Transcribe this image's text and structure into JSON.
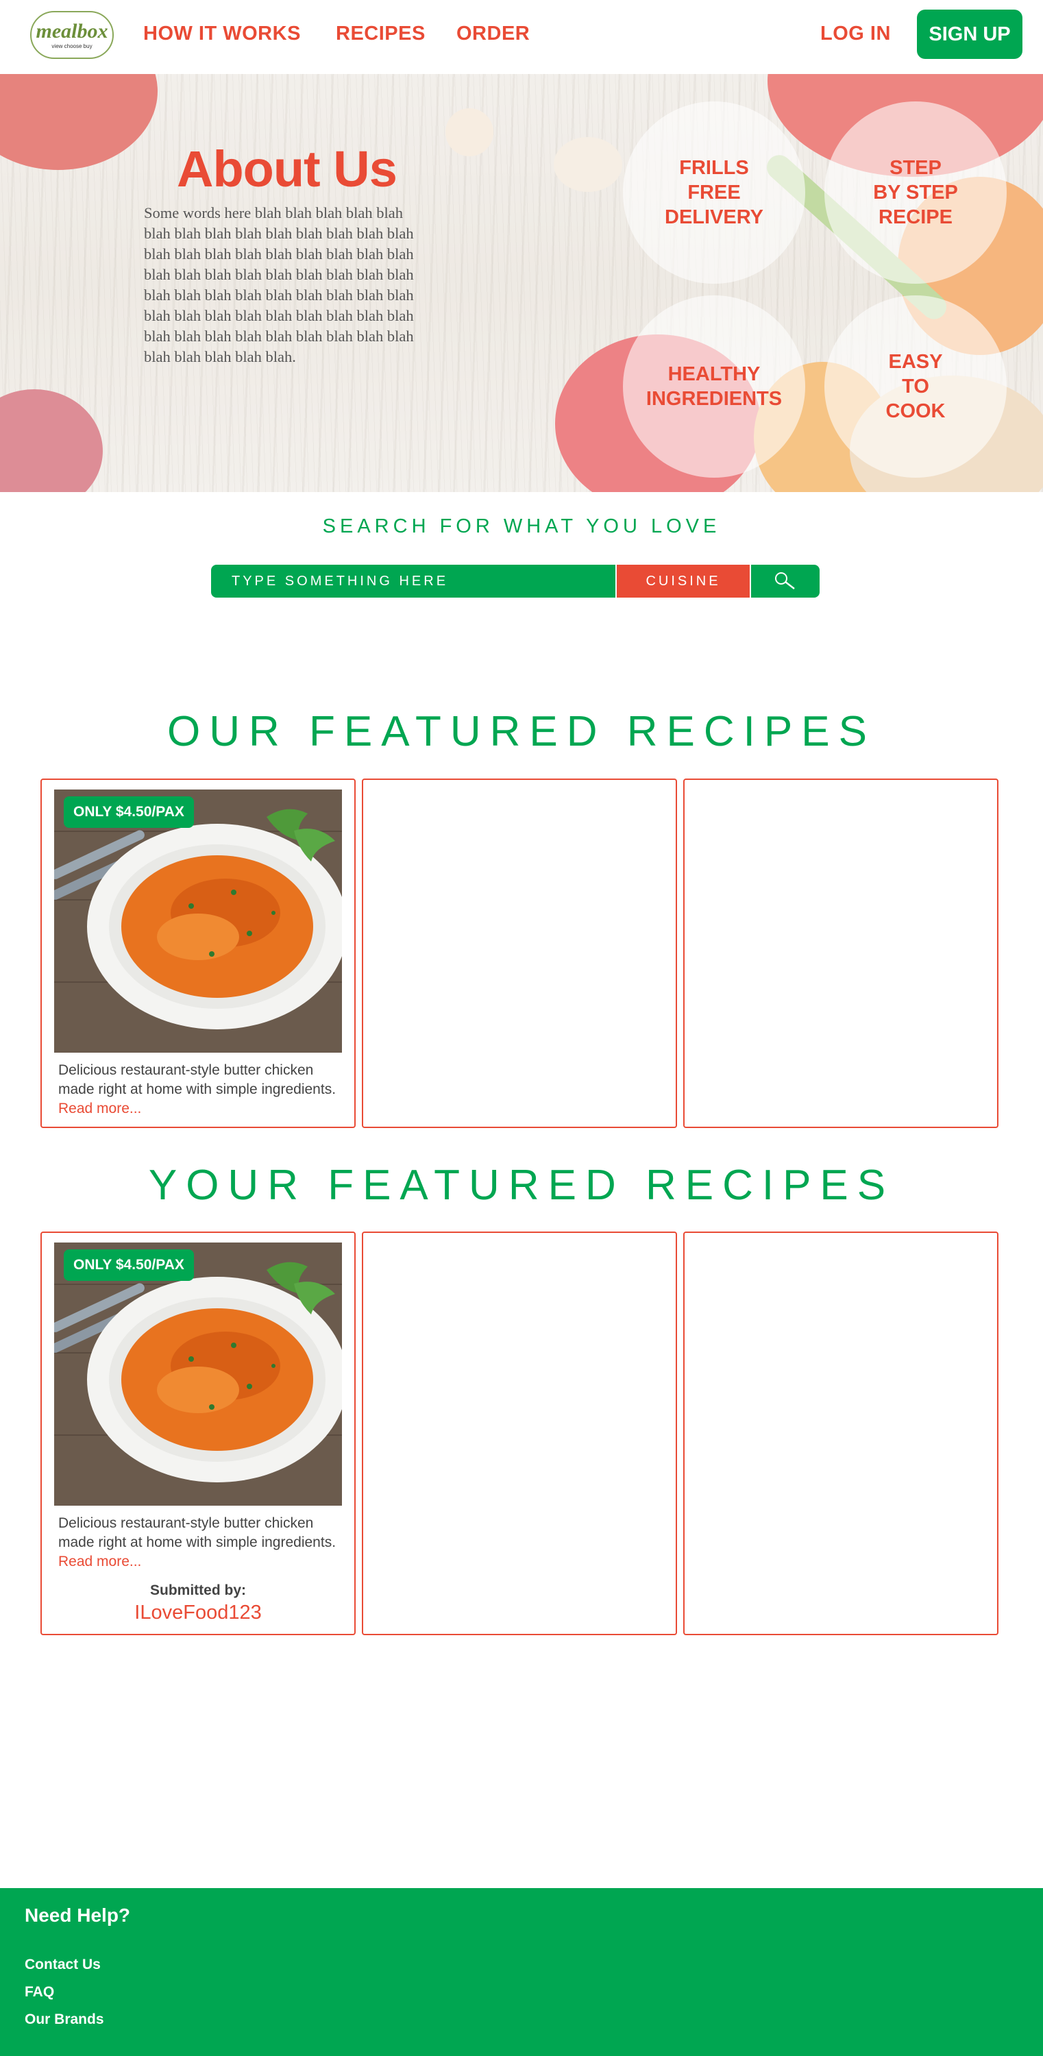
{
  "header": {
    "logo_text": "mealbox",
    "logo_tagline": "view choose buy",
    "nav": [
      "HOW IT WORKS",
      "RECIPES",
      "ORDER"
    ],
    "login_label": "LOG IN",
    "signup_label": "SIGN UP"
  },
  "hero": {
    "title": "About Us",
    "text": "Some words here blah blah blah blah blah blah blah blah blah blah blah blah blah blah blah blah blah blah blah blah blah blah blah blah blah blah blah blah blah blah blah blah blah blah blah blah blah blah blah blah blah blah blah blah blah blah blah blah blah blah blah blah blah blah blah blah blah blah blah blah blah blah blah blah.",
    "features": [
      "FRILLS\nFREE\nDELIVERY",
      "STEP\nBY STEP\nRECIPE",
      "HEALTHY\nINGREDIENTS",
      "EASY\nTO\nCOOK"
    ]
  },
  "search": {
    "heading": "SEARCH FOR WHAT YOU LOVE",
    "placeholder": "TYPE SOMETHING HERE",
    "cuisine_label": "CUISINE"
  },
  "our_featured": {
    "heading": "OUR FEATURED RECIPES",
    "cards": [
      {
        "badge": "ONLY $4.50/PAX",
        "description": "Delicious restaurant-style butter chicken made right at home with simple ingredients.",
        "read_more": "Read more..."
      }
    ]
  },
  "your_featured": {
    "heading": "YOUR FEATURED RECIPES",
    "cards": [
      {
        "badge": "ONLY $4.50/PAX",
        "description": "Delicious restaurant-style butter chicken made right at home with simple ingredients.",
        "read_more": "Read more...",
        "submitted_label": "Submitted by:",
        "submitted_user": "ILoveFood123"
      }
    ]
  },
  "footer": {
    "title": "Need Help?",
    "links": [
      "Contact Us",
      "FAQ",
      "Our Brands"
    ]
  },
  "colors": {
    "brand_red": "#e94b35",
    "brand_green": "#00a651"
  }
}
